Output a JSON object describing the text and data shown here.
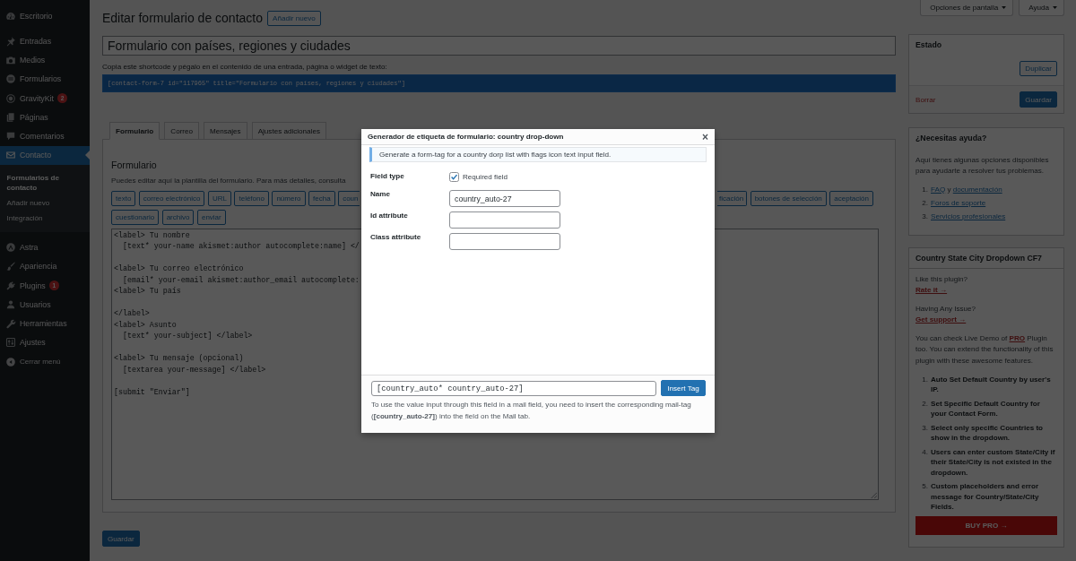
{
  "sidebar": {
    "sections": [
      {
        "items": [
          {
            "label": "Escritorio",
            "selected": false
          }
        ]
      },
      {
        "items": [
          {
            "label": "Entradas",
            "selected": false
          },
          {
            "label": "Medios",
            "selected": false
          },
          {
            "label": "Formularios",
            "selected": false
          },
          {
            "label": "GravityKit",
            "selected": false,
            "badge": "2"
          },
          {
            "label": "Páginas",
            "selected": false
          },
          {
            "label": "Comentarios",
            "selected": false
          },
          {
            "label": "Contacto",
            "selected": true,
            "children": [
              {
                "label": "Formularios de contacto",
                "selected": true
              },
              {
                "label": "Añadir nuevo",
                "selected": false
              },
              {
                "label": "Integración",
                "selected": false
              }
            ]
          }
        ]
      },
      {
        "items": [
          {
            "label": "Astra",
            "selected": false
          },
          {
            "label": "Apariencia",
            "selected": false
          },
          {
            "label": "Plugins",
            "selected": false,
            "badge": "1"
          },
          {
            "label": "Usuarios",
            "selected": false
          },
          {
            "label": "Herramientas",
            "selected": false
          },
          {
            "label": "Ajustes",
            "selected": false
          }
        ]
      }
    ],
    "collapse_label": "Cerrar menú"
  },
  "screen_tabs": [
    {
      "label": "Opciones de pantalla"
    },
    {
      "label": "Ayuda"
    }
  ],
  "page": {
    "title": "Editar formulario de contacto",
    "add_new_button": "Añadir nuevo"
  },
  "form_title": {
    "value": "Formulario con países, regiones y ciudades"
  },
  "shortcode": {
    "label": "Copia este shortcode y pégalo en el contenido de una entrada, página o widget de texto:",
    "value": "[contact-form-7 id=\"117965\" title=\"Formulario con países, regiones y ciudades\"]"
  },
  "tabs": [
    {
      "label": "Formulario",
      "selected": true
    },
    {
      "label": "Correo",
      "selected": false
    },
    {
      "label": "Mensajes",
      "selected": false
    },
    {
      "label": "Ajustes adicionales",
      "selected": false
    }
  ],
  "panel": {
    "heading": "Formulario",
    "description": "Puedes editar aquí la plantilla del formulario. Para más detalles, consulta",
    "tag_rows": [
      [
        {
          "label": "texto",
          "kind": "full"
        },
        {
          "label": "correo electrónico",
          "kind": "full"
        },
        {
          "label": "URL",
          "kind": "full"
        },
        {
          "label": "teléfono",
          "kind": "full"
        },
        {
          "label": "número",
          "kind": "full"
        },
        {
          "label": "fecha",
          "kind": "full"
        },
        {
          "label": "coun",
          "kind": "clipped_end"
        },
        {
          "label": "ficación",
          "kind": "clipped_start"
        },
        {
          "label": "botones de selección",
          "kind": "full"
        },
        {
          "label": "aceptación",
          "kind": "full"
        }
      ],
      [
        {
          "label": "cuestionario",
          "kind": "full"
        },
        {
          "label": "archivo",
          "kind": "full"
        },
        {
          "label": "enviar",
          "kind": "full"
        }
      ]
    ],
    "code_blocks": [
      [
        "<label> Tu nombre",
        "  [text* your-name akismet:author autocomplete:name] </"
      ],
      [
        "<label> Tu correo electrónico",
        "  [email* your-email akismet:author_email autocomplete:",
        "<label> Tu país"
      ],
      [
        "</label>",
        "<label> Asunto",
        "  [text* your-subject] </label>"
      ],
      [
        "<label> Tu mensaje (opcional)",
        "  [textarea your-message] </label>"
      ],
      [
        "[submit \"Enviar\"]"
      ]
    ]
  },
  "save_button": "Guardar",
  "status_box": {
    "title": "Estado",
    "duplicate_button": "Duplicar",
    "delete_link": "Borrar",
    "save_button": "Guardar"
  },
  "help_box": {
    "title": "¿Necesitas ayuda?",
    "text": "Aquí tienes algunas opciones disponibles para ayudarte a resolver tus problemas.",
    "items": [
      {
        "number": "1.",
        "parts": [
          {
            "kind": "link",
            "text": "FAQ"
          },
          {
            "kind": "text",
            "text": "y"
          },
          {
            "kind": "link",
            "text": "documentación"
          }
        ]
      },
      {
        "number": "2.",
        "parts": [
          {
            "kind": "link",
            "text": "Foros de soporte"
          }
        ]
      },
      {
        "number": "3.",
        "parts": [
          {
            "kind": "link",
            "text": "Servicios profesionales"
          }
        ]
      }
    ]
  },
  "plugin_box": {
    "title": "Country State City Dropdown CF7",
    "prompts": [
      {
        "question": "Like this plugin?",
        "link": "Rate it →"
      },
      {
        "question": "Having Any Issue?",
        "link": "Get support →"
      }
    ],
    "promo": [
      {
        "kind": "text",
        "text": "You can check Live Demo of"
      },
      {
        "kind": "link",
        "text": "PRO"
      },
      {
        "kind": "text",
        "text": "Plugin too. You can extend the functionality of this plugin with these awesome features."
      }
    ],
    "features": [
      {
        "number": "1.",
        "text": "Auto Set Default Country by user's IP."
      },
      {
        "number": "2.",
        "text": "Set Specific Default Country for your Contact Form."
      },
      {
        "number": "3.",
        "text": "Select only specific Countries to show in the dropdown."
      },
      {
        "number": "4.",
        "text": "Users can enter custom State/City if their State/City is not existed in the dropdown."
      },
      {
        "number": "5.",
        "text": "Custom placeholders and error message for Country/State/City Fields."
      }
    ],
    "buy_button": "BUY PRO →"
  },
  "modal": {
    "title": "Generador de etiqueta de formulario: country drop-down",
    "close": "×",
    "notice": "Generate a form-tag for a country dorp list with flags icon text input field.",
    "fields": [
      {
        "label": "Field type",
        "kind": "checkbox",
        "option": "Required field",
        "checked": true
      },
      {
        "label": "Name",
        "kind": "text",
        "value": "country_auto-27"
      },
      {
        "label": "Id attribute",
        "kind": "text"
      },
      {
        "label": "Class attribute",
        "kind": "text"
      }
    ],
    "tag_value": "[country_auto* country_auto-27]",
    "insert_button": "Insert Tag",
    "note": "To use the value input through this field in a mail field, you need to insert the corresponding mail-tag (**[country_auto-27]**) into the field on the Mail tab."
  }
}
